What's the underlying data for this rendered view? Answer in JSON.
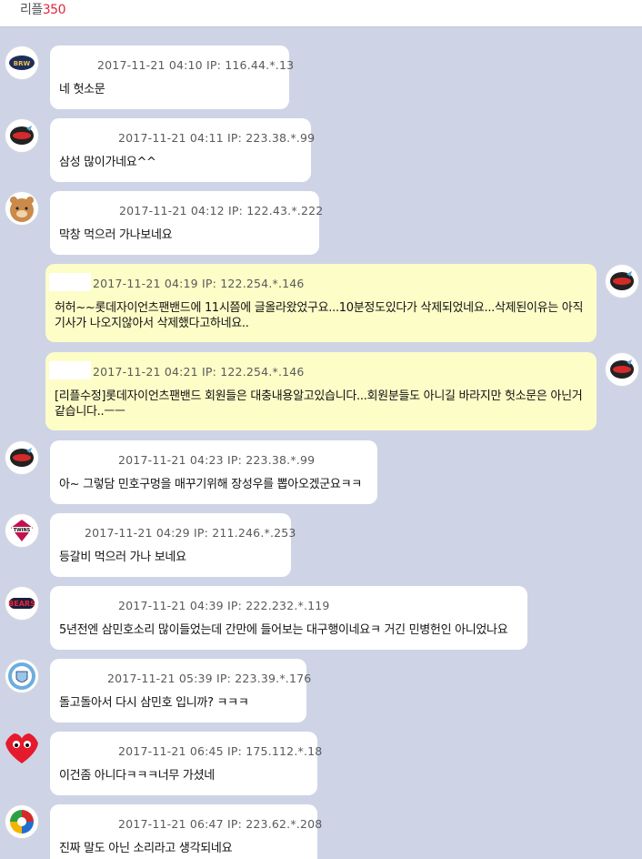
{
  "header": {
    "title": "리플",
    "count": "350"
  },
  "comments": [
    {
      "datetime": "2017-11-21 04:10",
      "ip": "IP: 116.44.*.13",
      "text": "네 헛소문",
      "avatar": "brewers-logo-icon"
    },
    {
      "datetime": "2017-11-21 04:11",
      "ip": "IP: 223.38.*.99",
      "text": "삼성 많이가네요^^",
      "avatar": "giants-logo-icon"
    },
    {
      "datetime": "2017-11-21 04:12",
      "ip": "IP: 122.43.*.222",
      "text": "막창 먹으러 가나보네요",
      "avatar": "bear-character-icon"
    },
    {
      "datetime": "2017-11-21 04:19",
      "ip": "IP: 122.254.*.146",
      "text": "허허~~롯데자이언츠팬밴드에 11시쯤에 글올라왔었구요...10분정도있다가 삭제되었네요...삭제된이유는 아직 기사가 나오지않아서 삭제했다고하네요..",
      "avatar": "giants-logo-icon"
    },
    {
      "datetime": "2017-11-21 04:21",
      "ip": "IP: 122.254.*.146",
      "text": "[리플수정]롯데자이언츠팬밴드 회원들은 대충내용알고있습니다...회원분들도 아니길 바라지만 헛소문은 아닌거 같습니다..ㅡㅡ",
      "avatar": "giants-logo-icon"
    },
    {
      "datetime": "2017-11-21 04:23",
      "ip": "IP: 223.38.*.99",
      "text": "아~ 그렇담 민호구멍을 매꾸기위해 장성우를 뽑아오겠군요ㅋㅋ",
      "avatar": "giants-logo-icon"
    },
    {
      "datetime": "2017-11-21 04:29",
      "ip": "IP: 211.246.*.253",
      "text": "등갈비 먹으러 가나 보네요",
      "avatar": "twins-logo-icon"
    },
    {
      "datetime": "2017-11-21 04:39",
      "ip": "IP: 222.232.*.119",
      "text": "5년전엔 삼민호소리 많이들었는데 간만에 들어보는 대구행이네요ㅋ 거긴 민병헌인 아니었나요",
      "avatar": "bears-logo-icon"
    },
    {
      "datetime": "2017-11-21 05:39",
      "ip": "IP: 223.39.*.176",
      "text": "돌고돌아서 다시 삼민호 입니까? ㅋㅋㅋ",
      "avatar": "mancity-logo-icon"
    },
    {
      "datetime": "2017-11-21 06:45",
      "ip": "IP: 175.112.*.18",
      "text": "이건좀 아니다ㅋㅋㅋ너무 가셨네",
      "avatar": "heart-icon"
    },
    {
      "datetime": "2017-11-21 06:47",
      "ip": "IP: 223.62.*.208",
      "text": "진짜 말도 아닌 소리라고 생각되네요",
      "avatar": "wbc-logo-icon"
    }
  ]
}
